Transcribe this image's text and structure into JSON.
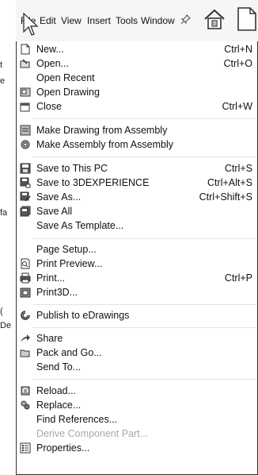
{
  "menubar": {
    "items": [
      "File",
      "Edit",
      "View",
      "Insert",
      "Tools",
      "Window"
    ],
    "pin_icon": "pin-icon",
    "home_icon": "home-icon",
    "new_doc_icon": "new-document-icon"
  },
  "background_fragments": [
    "t",
    "e",
    "fa",
    "(",
    "De"
  ],
  "file_menu": {
    "items": [
      {
        "label": "New...",
        "shortcut": "Ctrl+N",
        "icon": "new-document-icon"
      },
      {
        "label": "Open...",
        "shortcut": "Ctrl+O",
        "icon": "open-folder-icon"
      },
      {
        "label": "Open Recent",
        "shortcut": "",
        "icon": ""
      },
      {
        "label": "Open Drawing",
        "shortcut": "",
        "icon": "drawing-icon"
      },
      {
        "label": "Close",
        "shortcut": "Ctrl+W",
        "icon": "close-document-icon"
      },
      {
        "label": "Make Drawing from Assembly",
        "shortcut": "",
        "icon": "drawing-from-assembly-icon"
      },
      {
        "label": "Make Assembly from Assembly",
        "shortcut": "",
        "icon": "assembly-icon"
      },
      {
        "label": "Save to This PC",
        "shortcut": "Ctrl+S",
        "icon": "save-icon"
      },
      {
        "label": "Save to 3DEXPERIENCE",
        "shortcut": "Ctrl+Alt+S",
        "icon": "save-cloud-icon"
      },
      {
        "label": "Save As...",
        "shortcut": "Ctrl+Shift+S",
        "icon": "save-as-icon"
      },
      {
        "label": "Save All",
        "shortcut": "",
        "icon": "save-all-icon"
      },
      {
        "label": "Save As Template...",
        "shortcut": "",
        "icon": ""
      },
      {
        "label": "Page Setup...",
        "shortcut": "",
        "icon": ""
      },
      {
        "label": "Print Preview...",
        "shortcut": "",
        "icon": "print-preview-icon"
      },
      {
        "label": "Print...",
        "shortcut": "Ctrl+P",
        "icon": "printer-icon"
      },
      {
        "label": "Print3D...",
        "shortcut": "",
        "icon": "print3d-icon"
      },
      {
        "label": "Publish to eDrawings",
        "shortcut": "",
        "icon": "edrawings-icon"
      },
      {
        "label": "Share",
        "shortcut": "",
        "icon": "share-icon"
      },
      {
        "label": "Pack and Go...",
        "shortcut": "",
        "icon": "pack-and-go-icon"
      },
      {
        "label": "Send To...",
        "shortcut": "",
        "icon": ""
      },
      {
        "label": "Reload...",
        "shortcut": "",
        "icon": "reload-icon"
      },
      {
        "label": "Replace...",
        "shortcut": "",
        "icon": "replace-icon"
      },
      {
        "label": "Find References...",
        "shortcut": "",
        "icon": ""
      },
      {
        "label": "Derive Component Part...",
        "shortcut": "",
        "icon": "",
        "disabled": true
      },
      {
        "label": "Properties...",
        "shortcut": "",
        "icon": "properties-icon"
      }
    ]
  },
  "colors": {
    "menu_bg": "#ffffff",
    "menubar_bg": "#f6f6f6",
    "text": "#111111",
    "disabled_text": "#a8a8a8",
    "icon_dark": "#3a3a3a"
  }
}
